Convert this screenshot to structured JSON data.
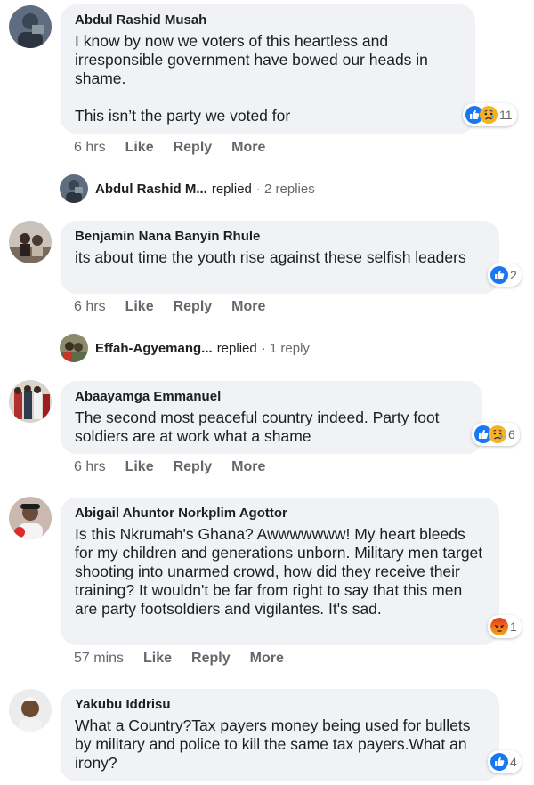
{
  "comments": [
    {
      "author": "Abdul Rashid Musah",
      "text": "I know by now we voters of this heartless and irresponsible government have bowed our heads in shame.\n\nThis isn’t the party we voted for",
      "time": "6 hrs",
      "like": "Like",
      "reply": "Reply",
      "more": "More",
      "reactions": [
        "like-icon",
        "sad-icon"
      ],
      "reaction_count": "11",
      "replies": {
        "name": "Abdul Rashid M...",
        "verb": "replied",
        "count": "· 2 replies"
      }
    },
    {
      "author": "Benjamin Nana Banyin Rhule",
      "text": "its about time the youth rise against these selfish leaders",
      "time": "6 hrs",
      "like": "Like",
      "reply": "Reply",
      "more": "More",
      "reactions": [
        "like-icon"
      ],
      "reaction_count": "2",
      "replies": {
        "name": "Effah-Agyemang...",
        "verb": "replied",
        "count": "· 1 reply"
      }
    },
    {
      "author": "Abaayamga Emmanuel",
      "text": "The second most peaceful country indeed. Party foot soldiers are at work what a shame",
      "time": "6 hrs",
      "like": "Like",
      "reply": "Reply",
      "more": "More",
      "reactions": [
        "like-icon",
        "sad-icon"
      ],
      "reaction_count": "6"
    },
    {
      "author": "Abigail Ahuntor Norkplim Agottor",
      "text": "Is this Nkrumah's Ghana? Awwwwwww! My heart bleeds for my children and generations unborn. Military men target shooting into unarmed crowd, how did they receive their training? It wouldn't be far from right to say that this men are party footsoldiers and vigilantes. It's sad.",
      "time": "57 mins",
      "like": "Like",
      "reply": "Reply",
      "more": "More",
      "reactions": [
        "angry-icon"
      ],
      "reaction_count": "1"
    },
    {
      "author": "Yakubu Iddrisu",
      "text": "What a Country?Tax payers money being used for bullets by military and police to kill the same tax payers.What an irony?",
      "reactions": [
        "like-icon"
      ],
      "reaction_count": "4"
    }
  ],
  "colors": {
    "bubble": "#f0f2f5",
    "like_blue": "#1877f2",
    "sad_yellow": "#f7b125",
    "angry_orange": "#e9710f",
    "meta_gray": "#65676b"
  }
}
